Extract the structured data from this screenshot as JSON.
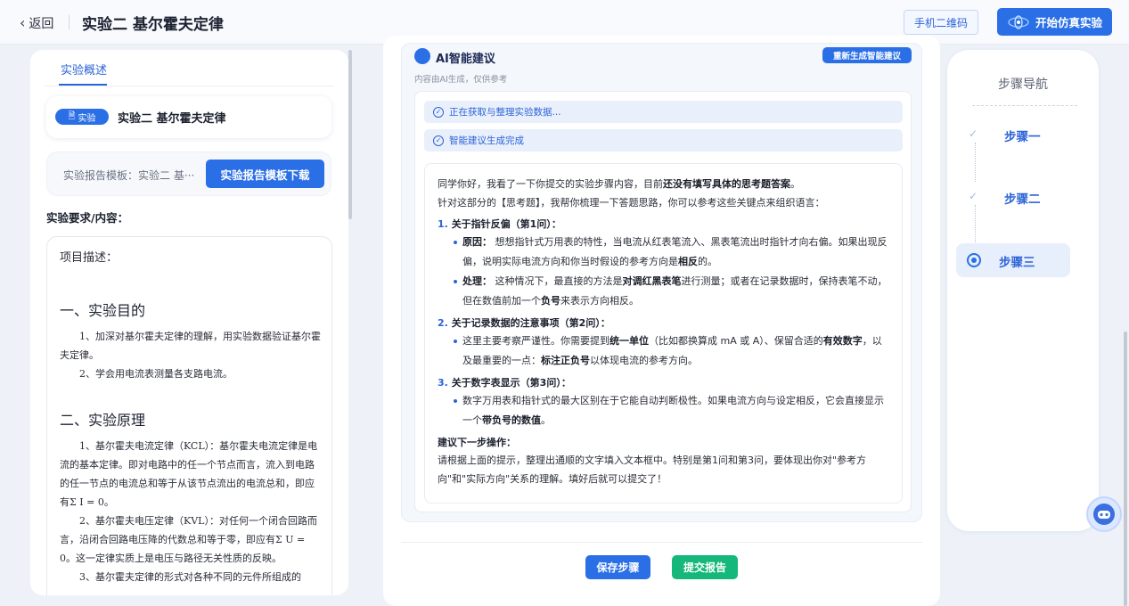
{
  "header": {
    "back_label": "返回",
    "title": "实验二 基尔霍夫定律",
    "qr_button": "手机二维码",
    "sim_button": "开始仿真实验"
  },
  "left": {
    "tab": "实验概述",
    "badge": "实验",
    "experiment_title": "实验二 基尔霍夫定律",
    "template_label": "实验报告模板：实验二 基···",
    "download_button": "实验报告模板下载",
    "requirements_heading": "实验要求/内容：",
    "doc": {
      "desc": "项目描述：",
      "h1": "一、实验目的",
      "p1": "1、加深对基尔霍夫定律的理解，用实验数据验证基尔霍夫定律。",
      "p2": "2、学会用电流表测量各支路电流。",
      "h2": "二、实验原理",
      "p3": "1、基尔霍夫电流定律（KCL）：基尔霍夫电流定律是电流的基本定律。即对电路中的任一个节点而言，流入到电路的任一节点的电流总和等于从该节点流出的电流总和，即应有Σ I = 0。",
      "p4": "2、基尔霍夫电压定律（KVL）：对任何一个闭合回路而言，沿闭合回路电压降的代数总和等于零，即应有Σ U = 0。这一定律实质上是电压与路径无关性质的反映。",
      "p5": "3、基尔霍夫定律的形式对各种不同的元件所组成的"
    }
  },
  "ai": {
    "title": "AI智能建议",
    "subtitle": "内容由AI生成，仅供参考",
    "regen_button": "重新生成智能建议",
    "status1": "正在获取与整理实验数据...",
    "status2": "智能建议生成完成",
    "intro_a": "同学你好，我看了一下你提交的实验步骤内容，目前",
    "intro_b": "还没有填写具体的思考题答案",
    "intro_c": "。",
    "intro2": "针对这部分的【思考题】，我帮你梳理一下答题思路，你可以参考这些关键点来组织语言：",
    "s1_num": "1.",
    "s1_title": "关于指针反偏（第1问）：",
    "s1_b1_k": "原因：",
    "s1_b1_a": "想想指针式万用表的特性，当电流从红表笔流入、黑表笔流出时指针才向右偏。如果出现反偏，说明实际电流方向和你当时假设的参考方向是",
    "s1_b1_b": "相反",
    "s1_b1_c": "的。",
    "s1_b2_k": "处理：",
    "s1_b2_a": "这种情况下，最直接的方法是",
    "s1_b2_b": "对调红黑表笔",
    "s1_b2_c": "进行测量；或者在记录数据时，保持表笔不动，但在数值前加一个",
    "s1_b2_d": "负号",
    "s1_b2_e": "来表示方向相反。",
    "s2_num": "2.",
    "s2_title": "关于记录数据的注意事项（第2问）：",
    "s2_b1_a": "这里主要考察严谨性。你需要提到",
    "s2_b1_b": "统一单位",
    "s2_b1_c": "（比如都换算成 mA 或 A）、保留合适的",
    "s2_b1_d": "有效数字",
    "s2_b1_e": "，以及最重要的一点：",
    "s2_b1_f": "标注正负号",
    "s2_b1_g": "以体现电流的参考方向。",
    "s3_num": "3.",
    "s3_title": "关于数字表显示（第3问）：",
    "s3_b1_a": "数字万用表和指针式的最大区别在于它能自动判断极性。如果电流方向与设定相反，它会直接显示一个",
    "s3_b1_b": "带负号的数值",
    "s3_b1_c": "。",
    "next_title": "建议下一步操作：",
    "next_text": "请根据上面的提示，整理出通顺的文字填入文本框中。特别是第1问和第3问，要体现出你对\"参考方向\"和\"实际方向\"关系的理解。填好后就可以提交了！"
  },
  "footer": {
    "save_button": "保存步骤",
    "submit_button": "提交报告"
  },
  "steps": {
    "title": "步骤导航",
    "items": [
      "步骤一",
      "步骤二",
      "步骤三"
    ]
  },
  "colors": {
    "primary": "#2b6fe6",
    "success": "#15b87a",
    "background": "#eef2f8"
  }
}
